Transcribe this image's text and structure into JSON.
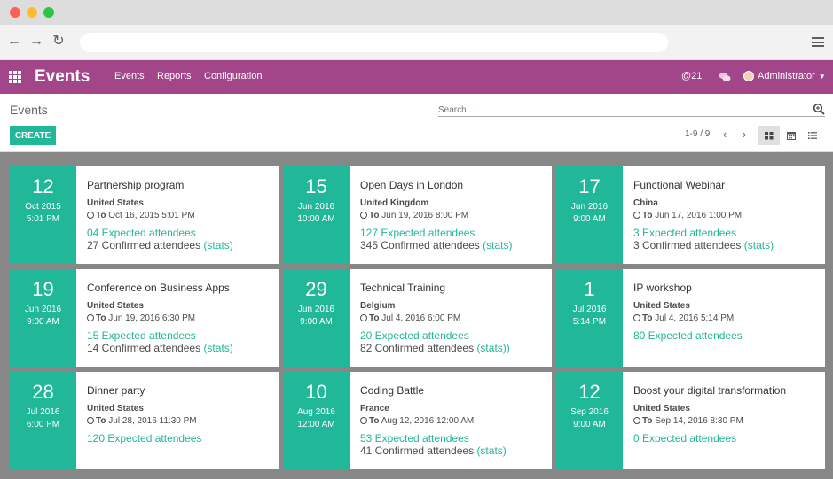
{
  "browser": {
    "url": ""
  },
  "app": {
    "title": "Events",
    "menu": [
      "Events",
      "Reports",
      "Configuration"
    ],
    "mentions": "@21",
    "user": "Administrator"
  },
  "control": {
    "breadcrumb": "Events",
    "search_placeholder": "Search...",
    "create_label": "CREATE",
    "pager": "1-9 / 9"
  },
  "colors": {
    "brand": "#a24689",
    "accent": "#21b799",
    "kanban_bg": "#878787"
  },
  "icons": [
    "back-icon",
    "forward-icon",
    "reload-icon",
    "menu-icon",
    "apps-icon",
    "chat-icon",
    "search-icon",
    "kanban-view-icon",
    "calendar-view-icon",
    "list-view-icon",
    "clock-icon"
  ],
  "cards": [
    {
      "day": "12",
      "month": "Oct 2015",
      "time": "5:01 PM",
      "name": "Partnership program",
      "country": "United States",
      "to_label": "To",
      "to_date": "Oct 16, 2015 5:01 PM",
      "expected": "04 Expected attendees",
      "confirmed": "27 Confirmed attendees",
      "stats": "(stats)"
    },
    {
      "day": "15",
      "month": "Jun 2016",
      "time": "10:00 AM",
      "name": "Open Days in London",
      "country": "United Kingdom",
      "to_label": "To",
      "to_date": "Jun 19, 2016 8:00 PM",
      "expected": "127 Expected attendees",
      "confirmed": "345 Confirmed attendees",
      "stats": "(stats)"
    },
    {
      "day": "17",
      "month": "Jun 2016",
      "time": "9:00 AM",
      "name": "Functional Webinar",
      "country": "China",
      "to_label": "To",
      "to_date": "Jun 17, 2016 1:00 PM",
      "expected": "3 Expected attendees",
      "confirmed": "3 Confirmed attendees",
      "stats": "(stats)"
    },
    {
      "day": "19",
      "month": "Jun 2016",
      "time": "9:00 AM",
      "name": "Conference on Business Apps",
      "country": "United States",
      "to_label": "To",
      "to_date": "Jun 19, 2016 6:30 PM",
      "expected": "15 Expected attendees",
      "confirmed": "14 Confirmed attendees",
      "stats": "(stats)"
    },
    {
      "day": "29",
      "month": "Jun 2016",
      "time": "9:00 AM",
      "name": "Technical Training",
      "country": "Belgium",
      "to_label": "To",
      "to_date": "Jul 4, 2016 6:00 PM",
      "expected": "20 Expected attendees",
      "confirmed": "82 Confirmed attendees",
      "stats": "(stats))"
    },
    {
      "day": "1",
      "month": "Jul 2016",
      "time": "5:14 PM",
      "name": "IP workshop",
      "country": "United States",
      "to_label": "To",
      "to_date": "Jul 4, 2016 5:14 PM",
      "expected": "80 Expected attendees",
      "confirmed": "",
      "stats": ""
    },
    {
      "day": "28",
      "month": "Jul 2016",
      "time": "6:00 PM",
      "name": "Dinner party",
      "country": "United States",
      "to_label": "To",
      "to_date": "Jul 28, 2016 11:30 PM",
      "expected": "120 Expected attendees",
      "confirmed": "",
      "stats": ""
    },
    {
      "day": "10",
      "month": "Aug 2016",
      "time": "12:00 AM",
      "name": "Coding Battle",
      "country": "France",
      "to_label": "To",
      "to_date": "Aug 12, 2016 12:00 AM",
      "expected": "53 Expected attendees",
      "confirmed": "41 Confirmed attendees",
      "stats": "(stats)"
    },
    {
      "day": "12",
      "month": "Sep 2016",
      "time": "9:00 AM",
      "name": "Boost your digital transformation",
      "country": "United States",
      "to_label": "To",
      "to_date": "Sep 14, 2016 8:30 PM",
      "expected": "0 Expected attendees",
      "confirmed": "",
      "stats": ""
    }
  ]
}
